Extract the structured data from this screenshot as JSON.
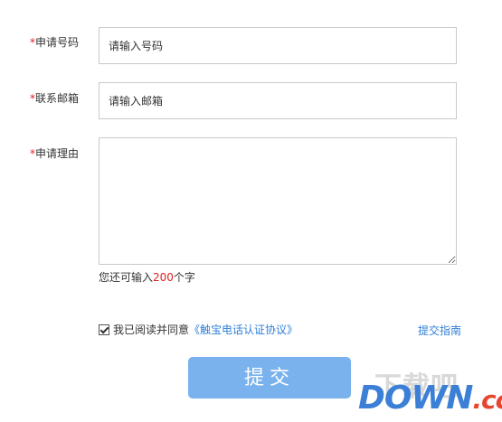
{
  "form": {
    "phone": {
      "label": "申请号码",
      "required_mark": "*",
      "placeholder": "请输入号码"
    },
    "email": {
      "label": "联系邮箱",
      "required_mark": "*",
      "placeholder": "请输入邮箱"
    },
    "reason": {
      "label": "申请理由",
      "required_mark": "*",
      "value": ""
    },
    "counter": {
      "prefix": "您还可输入",
      "remaining": "200",
      "suffix": "个字"
    },
    "agreement": {
      "checked": true,
      "text": "我已阅读并同意",
      "link": "《触宝电话认证协议》"
    },
    "guide_link": "提交指南",
    "submit_label": "提交"
  },
  "watermark": {
    "ghost": "下载吧",
    "brand_main": "DOWN",
    "brand_suffix": ".cc"
  },
  "colors": {
    "accent": "#2f7fd8",
    "button": "#79b2ec",
    "required": "#e02020"
  }
}
